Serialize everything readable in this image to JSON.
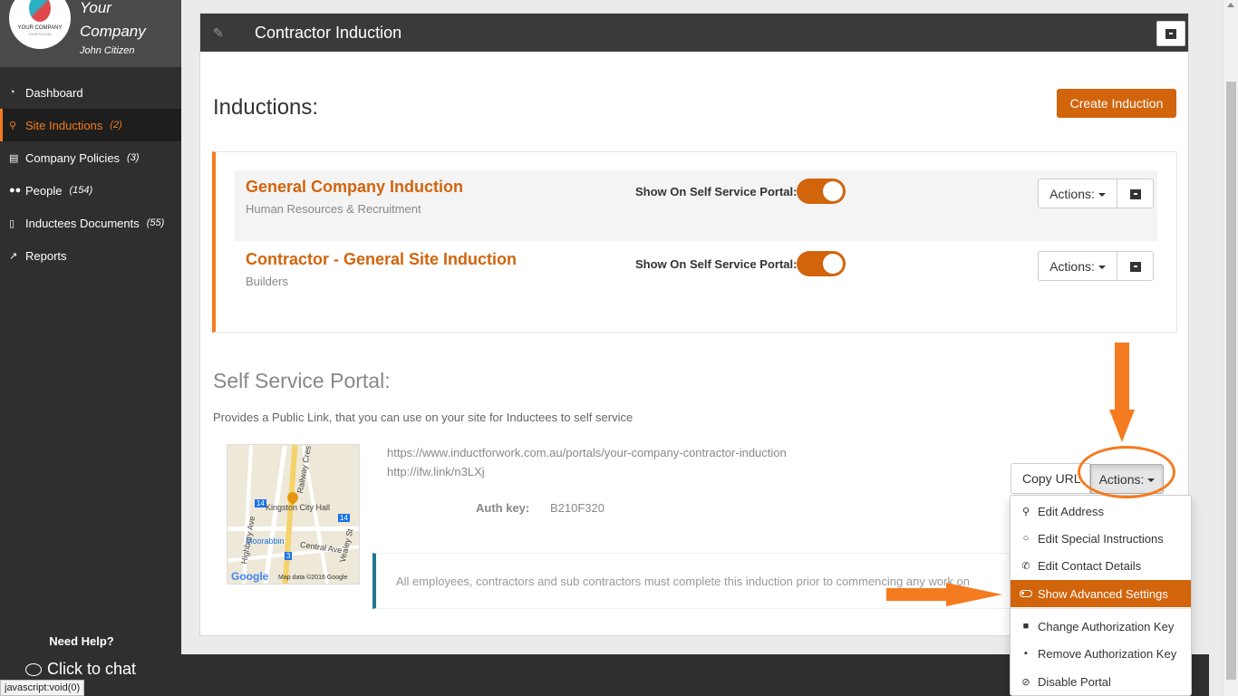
{
  "sidebar": {
    "brand_name": "Your Company",
    "logo_text": "YOUR COMPANY",
    "logo_tagline": "YOUR SLOGAN",
    "user_name": "John Citizen",
    "items": [
      {
        "label": "Dashboard",
        "count": "",
        "icon": "dashboard-icon"
      },
      {
        "label": "Site Inductions",
        "count": "(2)",
        "icon": "map-marker-icon"
      },
      {
        "label": "Company Policies",
        "count": "(3)",
        "icon": "book-icon"
      },
      {
        "label": "People",
        "count": "(154)",
        "icon": "users-icon"
      },
      {
        "label": "Inductees Documents",
        "count": "(55)",
        "icon": "document-icon"
      },
      {
        "label": "Reports",
        "count": "",
        "icon": "chart-icon"
      }
    ],
    "help_title": "Need Help?",
    "chat_label": "Click to chat"
  },
  "statusbar": "javascript:void(0)",
  "panel": {
    "title": "Contractor Induction",
    "inductions_heading": "Inductions:",
    "create_button": "Create Induction",
    "inductions": [
      {
        "title": "General Company Induction",
        "subtitle": "Human Resources & Recruitment",
        "portal_label": "Show On Self Service Portal:",
        "toggle_on": true,
        "actions_label": "Actions:"
      },
      {
        "title": "Contractor - General Site Induction",
        "subtitle": "Builders",
        "portal_label": "Show On Self Service Portal:",
        "toggle_on": true,
        "actions_label": "Actions:"
      }
    ],
    "ssp_heading": "Self Service Portal:",
    "ssp_description": "Provides a Public Link, that you can use on your site for Inductees to self service",
    "portal_url": "https://www.inductforwork.com.au/portals/your-company-contractor-induction",
    "short_url": "http://ifw.link/n3LXj",
    "auth_key_label": "Auth key:",
    "auth_key_value": "B210F320",
    "notice": "All employees, contractors and sub contractors must complete this induction prior to commencing any work on",
    "copy_button": "Copy URL",
    "actions_button": "Actions:"
  },
  "map": {
    "labels": [
      "Kingston City Hall",
      "Moorabbin",
      "Central Ave",
      "Highbury Ave",
      "Railway Cres",
      "Vealey St"
    ],
    "google": "Google",
    "map_data": "Map data ©2016 Google",
    "road_badges": [
      "14",
      "14",
      "3"
    ]
  },
  "dropdown": {
    "items": [
      {
        "label": "Edit Address",
        "icon": "map-marker-icon"
      },
      {
        "label": "Edit Special Instructions",
        "icon": "comment-icon"
      },
      {
        "label": "Edit Contact Details",
        "icon": "phone-icon"
      },
      {
        "label": "Show Advanced Settings",
        "icon": "toggle-icon",
        "highlighted": true
      },
      {
        "label": "Change Authorization Key",
        "icon": "lock-icon"
      },
      {
        "label": "Remove Authorization Key",
        "icon": "unlock-icon"
      },
      {
        "label": "Disable Portal",
        "icon": "ban-icon"
      }
    ]
  },
  "colors": {
    "accent": "#d2640c",
    "accent_bright": "#f47b1f",
    "sidebar_bg": "#2f2f2f",
    "notice_border": "#1f7891"
  }
}
